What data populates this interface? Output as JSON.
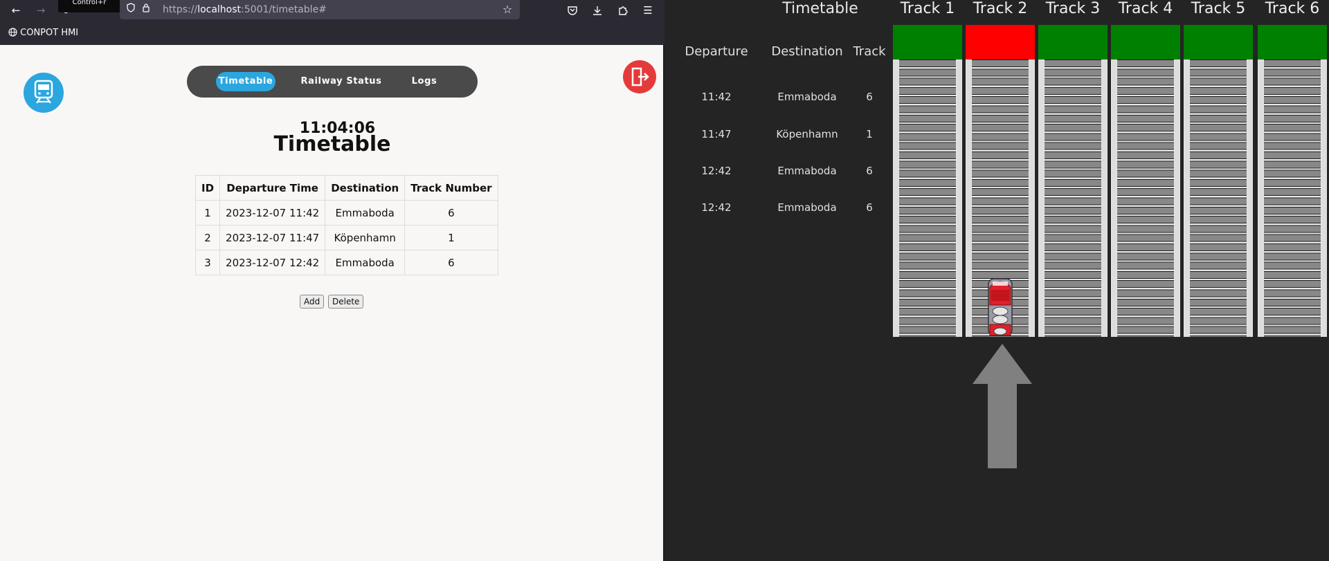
{
  "browser": {
    "tooltip": "Control+r",
    "url_scheme": "https://",
    "url_host": "localhost",
    "url_rest": ":5001/timetable#",
    "bookmark_label": "CONPOT HMI"
  },
  "app": {
    "tabs": [
      {
        "label": "Timetable",
        "active": true
      },
      {
        "label": "Railway Status",
        "active": false
      },
      {
        "label": "Logs",
        "active": false
      }
    ],
    "clock": "11:04:06",
    "title": "Timetable",
    "table": {
      "headers": [
        "ID",
        "Departure Time",
        "Destination",
        "Track Number"
      ],
      "rows": [
        [
          "1",
          "2023-12-07 11:42",
          "Emmaboda",
          "6"
        ],
        [
          "2",
          "2023-12-07 11:47",
          "Köpenhamn",
          "1"
        ],
        [
          "3",
          "2023-12-07 12:42",
          "Emmaboda",
          "6"
        ]
      ]
    },
    "add_label": "Add",
    "delete_label": "Delete",
    "logo_color": "#2ba6de",
    "logout_color": "#e53a3a"
  },
  "hmi": {
    "title": "Timetable",
    "headers": [
      "Departure",
      "Destination",
      "Track"
    ],
    "rows": [
      {
        "time": "11:42",
        "destination": "Emmaboda",
        "track": "6"
      },
      {
        "time": "11:47",
        "destination": "Köpenhamn",
        "track": "1"
      },
      {
        "time": "12:42",
        "destination": "Emmaboda",
        "track": "6"
      },
      {
        "time": "12:42",
        "destination": "Emmaboda",
        "track": "6"
      }
    ],
    "tracks": [
      {
        "label": "Track 1",
        "signal": "green"
      },
      {
        "label": "Track 2",
        "signal": "red"
      },
      {
        "label": "Track 3",
        "signal": "green"
      },
      {
        "label": "Track 4",
        "signal": "green"
      },
      {
        "label": "Track 5",
        "signal": "green"
      },
      {
        "label": "Track 6",
        "signal": "green"
      }
    ],
    "signal_colors": {
      "green": "#008000",
      "red": "#ff0000"
    },
    "train_track": "Track 2"
  }
}
